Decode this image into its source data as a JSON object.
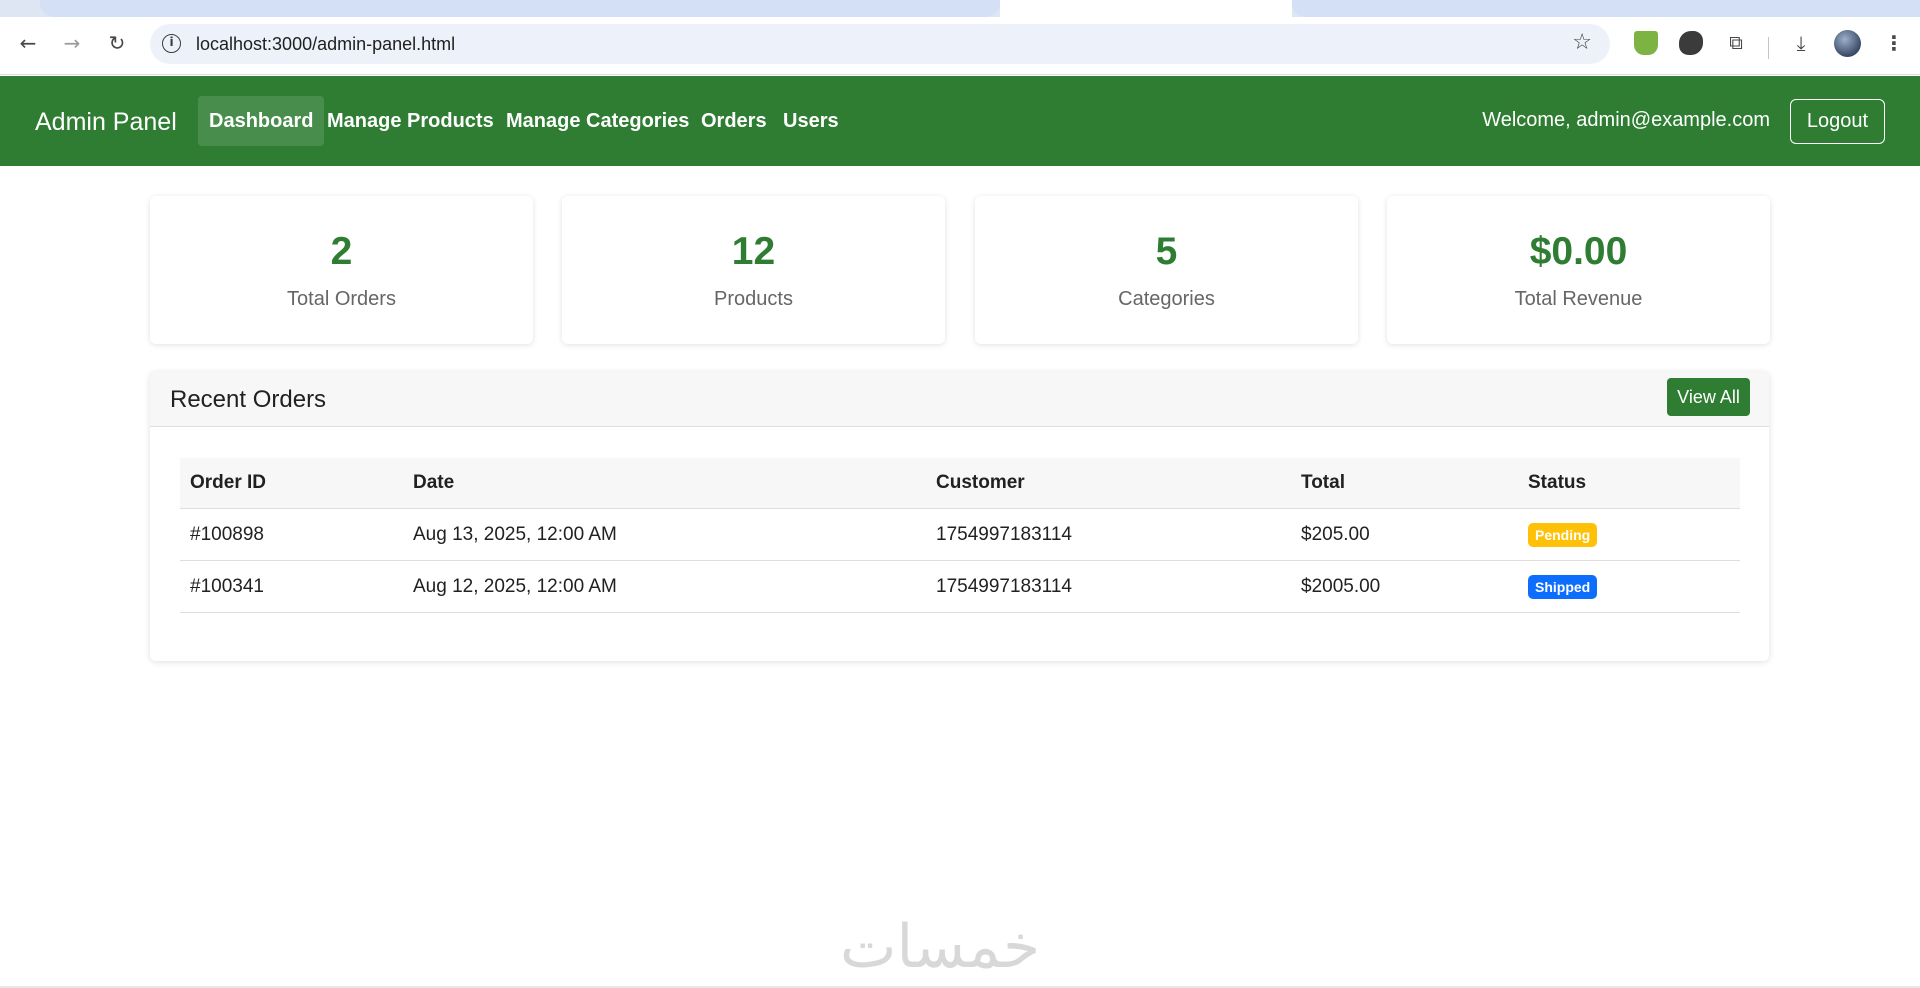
{
  "browser": {
    "url": "localhost:3000/admin-panel.html"
  },
  "nav": {
    "brand": "Admin Panel",
    "items": [
      "Dashboard",
      "Manage Products",
      "Manage Categories",
      "Orders",
      "Users"
    ],
    "active": "Dashboard",
    "welcome": "Welcome, admin@example.com",
    "logout": "Logout",
    "color": "#2e7d32"
  },
  "stats": [
    {
      "value": "2",
      "label": "Total Orders"
    },
    {
      "value": "12",
      "label": "Products"
    },
    {
      "value": "5",
      "label": "Categories"
    },
    {
      "value": "$0.00",
      "label": "Total Revenue"
    }
  ],
  "recent_orders": {
    "title": "Recent Orders",
    "view_all": "View All",
    "columns": [
      "Order ID",
      "Date",
      "Customer",
      "Total",
      "Status"
    ],
    "rows": [
      {
        "id": "#100898",
        "date": "Aug 13, 2025, 12:00 AM",
        "customer": "1754997183114",
        "total": "$205.00",
        "status": "Pending"
      },
      {
        "id": "#100341",
        "date": "Aug 12, 2025, 12:00 AM",
        "customer": "1754997183114",
        "total": "$2005.00",
        "status": "Shipped"
      }
    ]
  },
  "watermark": "خمسات"
}
